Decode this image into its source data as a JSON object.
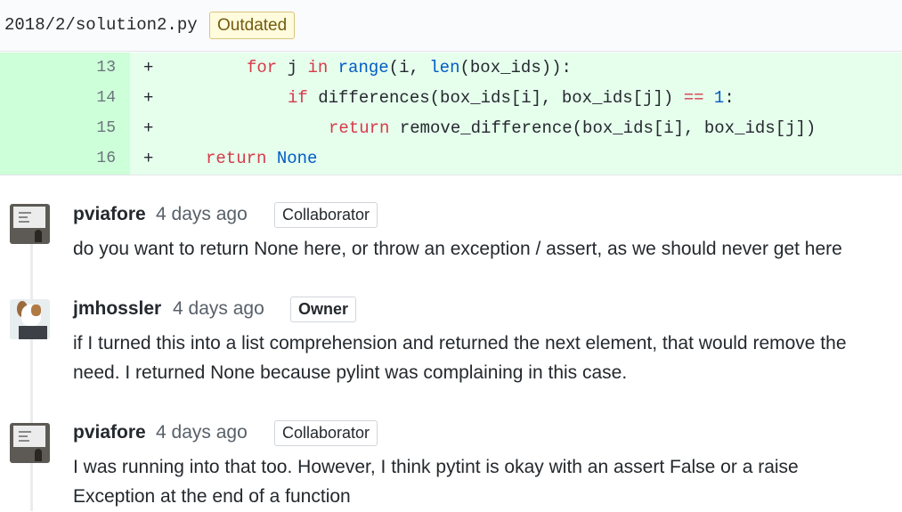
{
  "file": {
    "path": "2018/2/solution2.py",
    "status_badge": "Outdated"
  },
  "diff": {
    "lines": [
      {
        "number": "13",
        "marker": "+",
        "code": "for j in range(i, len(box_ids)):"
      },
      {
        "number": "14",
        "marker": "+",
        "code": "if differences(box_ids[i], box_ids[j]) == 1:"
      },
      {
        "number": "15",
        "marker": "+",
        "code": "return remove_difference(box_ids[i], box_ids[j])"
      },
      {
        "number": "16",
        "marker": "+",
        "code": "return None"
      }
    ]
  },
  "comments": [
    {
      "author": "pviafore",
      "time": "4 days ago",
      "role": "Collaborator",
      "body": "do you want to return None here, or throw an exception / assert, as we should never get here"
    },
    {
      "author": "jmhossler",
      "time": "4 days ago",
      "role": "Owner",
      "body": "if I turned this into a list comprehension and returned the next element, that would remove the need. I returned None because pylint was complaining in this case."
    },
    {
      "author": "pviafore",
      "time": "4 days ago",
      "role": "Collaborator",
      "body": "I was running into that too. However, I think pytint is okay with an assert False or a raise Exception at the end of a function"
    }
  ],
  "colors": {
    "added_line_bg": "#e6ffed",
    "added_gutter_bg": "#cdffd8",
    "keyword": "#d73a49",
    "builtin": "#005cc5",
    "outdated_badge_bg": "#fffbdd"
  },
  "icons": {
    "avatar_1": "presentation-slide-avatar",
    "avatar_2": "dog-with-laptop-avatar"
  }
}
